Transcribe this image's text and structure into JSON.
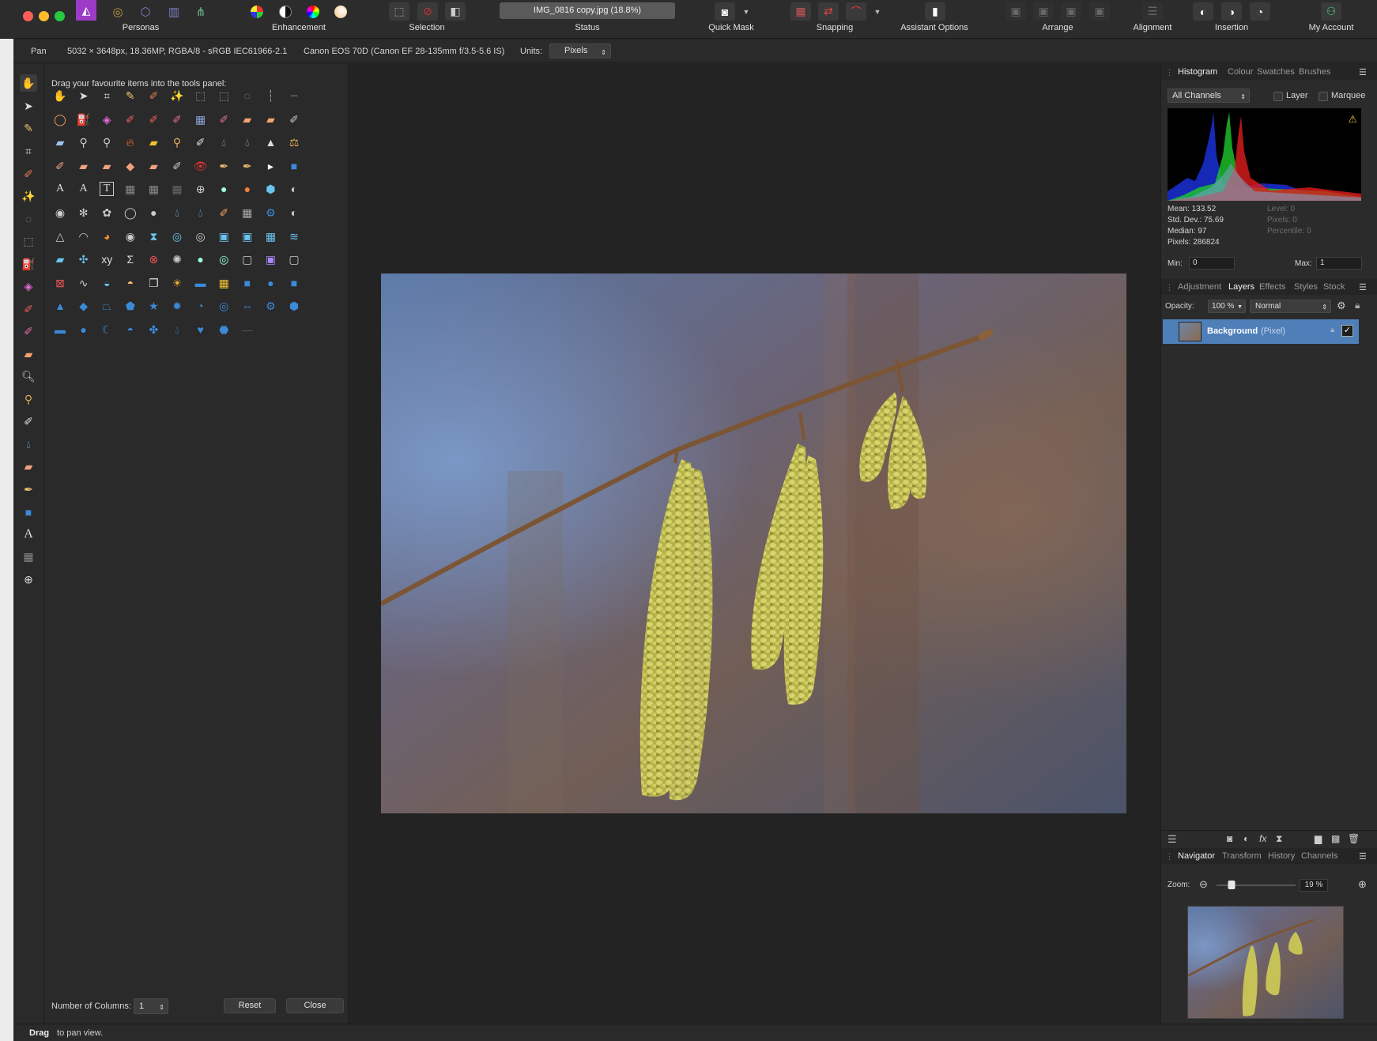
{
  "colors": {
    "accent": "#3b7ad0",
    "layer_selected": "#4f7fb8",
    "window_bg": "#262626"
  },
  "toolbar": {
    "personas_label": "Personas",
    "enhancement_label": "Enhancement",
    "selection_label": "Selection",
    "status_label": "Status",
    "status_text": "IMG_0816 copy.jpg (18.8%)",
    "quick_mask_label": "Quick Mask",
    "snapping_label": "Snapping",
    "assistant_label": "Assistant Options",
    "arrange_label": "Arrange",
    "alignment_label": "Alignment",
    "insertion_label": "Insertion",
    "account_label": "My Account"
  },
  "context": {
    "tool": "Pan",
    "doc_info": "5032 × 3648px, 18.36MP, RGBA/8 - sRGB IEC61966-2.1",
    "camera": "Canon EOS 70D (Canon EF 28-135mm f/3.5-5.6 IS)",
    "units_label": "Units:",
    "units_value": "Pixels"
  },
  "customize": {
    "hint": "Drag your favourite items into the tools panel:",
    "columns_label": "Number of Columns:",
    "columns_value": "1",
    "reset": "Reset",
    "close": "Close",
    "special_labels": {
      "xy": "xy",
      "sigma": "Σ",
      "A": "A"
    }
  },
  "histogram": {
    "tabs": [
      "Histogram",
      "Colour",
      "Swatches",
      "Brushes"
    ],
    "channel": "All Channels",
    "layer_label": "Layer",
    "marquee_label": "Marquee",
    "mean": "Mean: 133.52",
    "stddev": "Std. Dev.: 75.69",
    "median": "Median: 97",
    "pixels": "Pixels: 286824",
    "level": "Level: 0",
    "pixels_r": "Pixels: 0",
    "percentile": "Percentile: 0",
    "min_label": "Min:",
    "min_value": "0",
    "max_label": "Max:",
    "max_value": "1"
  },
  "layers": {
    "tabs": [
      "Adjustment",
      "Layers",
      "Effects",
      "Styles",
      "Stock"
    ],
    "opacity_label": "Opacity:",
    "opacity_value": "100 %",
    "blend": "Normal",
    "layer_name": "Background",
    "layer_type": "(Pixel)"
  },
  "navigator": {
    "tabs": [
      "Navigator",
      "Transform",
      "History",
      "Channels"
    ],
    "zoom_label": "Zoom:",
    "zoom_value": "19 %",
    "zoom_fraction": 0.19
  },
  "status_bar": {
    "bold": "Drag",
    "rest": " to pan view."
  }
}
